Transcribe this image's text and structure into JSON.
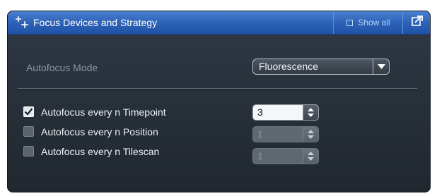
{
  "panel": {
    "title": "Focus Devices and Strategy",
    "show_all_label": "Show all"
  },
  "autofocus_mode": {
    "label": "Autofocus Mode",
    "selected": "Fluorescence"
  },
  "options": [
    {
      "label": "Autofocus every n Timepoint",
      "checked": true,
      "value": "3",
      "enabled": true
    },
    {
      "label": "Autofocus every n Position",
      "checked": false,
      "value": "1",
      "enabled": false
    },
    {
      "label": "Autofocus every n Tilescan",
      "checked": false,
      "value": "1",
      "enabled": false
    }
  ],
  "colors": {
    "header_blue": "#2d63b8",
    "panel_bg": "#2a323c"
  },
  "icons": {
    "header": "focus-crosshair-icon",
    "undock": "undock-window-icon",
    "dropdown": "chevron-down-icon",
    "check": "checkmark-icon"
  }
}
